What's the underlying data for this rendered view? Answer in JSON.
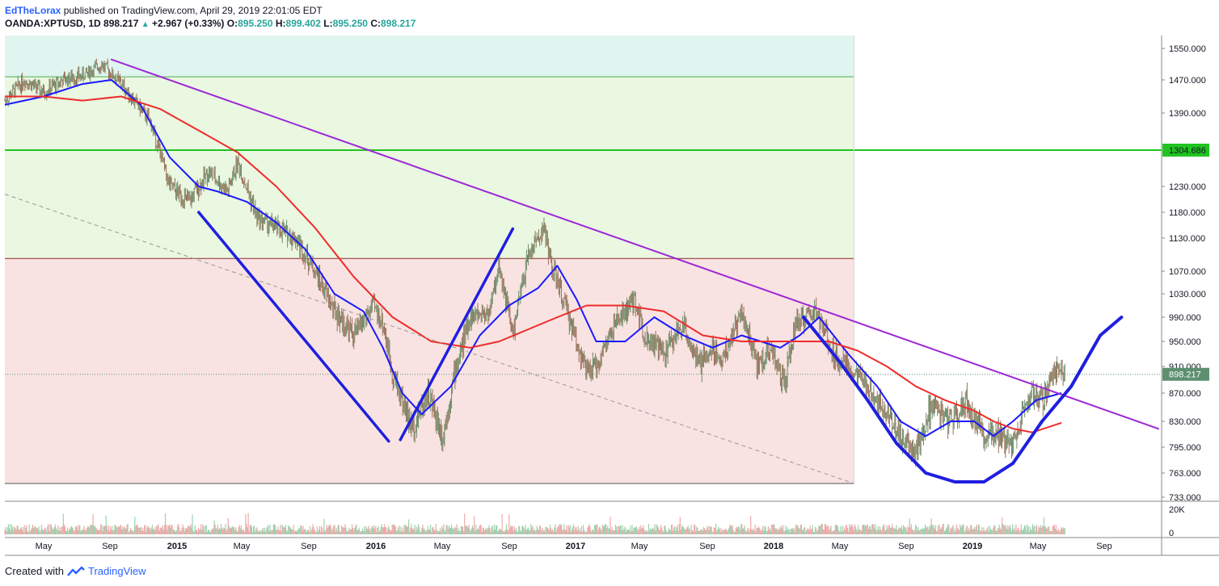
{
  "header": {
    "author": "EdTheLorax",
    "published": "published on TradingView.com, April 29, 2019 22:01:05 EDT",
    "symbol": "OANDA:XPTUSD, 1D",
    "last": "898.217",
    "change_arrow": "▲",
    "change": "+2.967 (+0.33%)",
    "o_label": "O:",
    "o": "895.250",
    "h_label": "H:",
    "h": "899.402",
    "l_label": "L:",
    "l": "895.250",
    "c_label": "C:",
    "c": "898.217"
  },
  "footer": {
    "created_with": "Created with",
    "brand": "TradingView",
    "logo_icon": "tradingview-logo-icon"
  },
  "colors": {
    "ma_fast": "#1a1aff",
    "ma_slow": "#ef2b2b",
    "trend": "#9c27d6",
    "channel": "#1f1fe0",
    "level_green": "#21c321",
    "candle_up": "#6c8e6a",
    "candle_down": "#9a7058",
    "zone_top": "#e0f5ef",
    "zone_mid": "#eaf7e1",
    "zone_low": "#f8e3e2",
    "last_price_tag": "#5d8f70"
  },
  "chart_data": {
    "type": "line",
    "title": "",
    "price_ticks": [
      "1550.000",
      "1470.000",
      "1390.000",
      "1304.686",
      "1230.000",
      "1180.000",
      "1130.000",
      "1070.000",
      "1030.000",
      "990.000",
      "950.000",
      "910.000",
      "898.217",
      "870.000",
      "830.000",
      "795.000",
      "763.000",
      "733.000"
    ],
    "volume_ticks": [
      "20K",
      "0"
    ],
    "time_ticks": [
      "May",
      "Sep",
      "2015",
      "May",
      "Sep",
      "2016",
      "May",
      "Sep",
      "2017",
      "May",
      "Sep",
      "2018",
      "May",
      "Sep",
      "2019",
      "May",
      "Sep"
    ],
    "last_price": 898.217,
    "horizontal_levels": [
      1478,
      1304.686,
      1093,
      750
    ],
    "x_unit": "years (decimal)",
    "price_path": [
      [
        2014.0,
        1420
      ],
      [
        2014.1,
        1470
      ],
      [
        2014.2,
        1440
      ],
      [
        2014.3,
        1470
      ],
      [
        2014.4,
        1480
      ],
      [
        2014.5,
        1510
      ],
      [
        2014.6,
        1460
      ],
      [
        2014.75,
        1370
      ],
      [
        2014.85,
        1230
      ],
      [
        2014.95,
        1200
      ],
      [
        2015.05,
        1260
      ],
      [
        2015.15,
        1220
      ],
      [
        2015.2,
        1280
      ],
      [
        2015.3,
        1170
      ],
      [
        2015.4,
        1150
      ],
      [
        2015.5,
        1130
      ],
      [
        2015.6,
        1070
      ],
      [
        2015.7,
        1000
      ],
      [
        2015.8,
        960
      ],
      [
        2015.9,
        1010
      ],
      [
        2015.95,
        980
      ],
      [
        2016.0,
        900
      ],
      [
        2016.05,
        860
      ],
      [
        2016.1,
        820
      ],
      [
        2016.18,
        870
      ],
      [
        2016.26,
        810
      ],
      [
        2016.32,
        900
      ],
      [
        2016.4,
        990
      ],
      [
        2016.5,
        1000
      ],
      [
        2016.55,
        1080
      ],
      [
        2016.62,
        960
      ],
      [
        2016.7,
        1100
      ],
      [
        2016.78,
        1150
      ],
      [
        2016.82,
        1080
      ],
      [
        2016.88,
        1020
      ],
      [
        2016.95,
        950
      ],
      [
        2017.0,
        900
      ],
      [
        2017.05,
        910
      ],
      [
        2017.15,
        980
      ],
      [
        2017.25,
        1020
      ],
      [
        2017.3,
        960
      ],
      [
        2017.4,
        930
      ],
      [
        2017.5,
        980
      ],
      [
        2017.58,
        910
      ],
      [
        2017.65,
        940
      ],
      [
        2017.7,
        920
      ],
      [
        2017.8,
        1000
      ],
      [
        2017.88,
        910
      ],
      [
        2017.95,
        940
      ],
      [
        2018.02,
        880
      ],
      [
        2018.08,
        980
      ],
      [
        2018.18,
        1000
      ],
      [
        2018.28,
        930
      ],
      [
        2018.38,
        900
      ],
      [
        2018.48,
        870
      ],
      [
        2018.56,
        840
      ],
      [
        2018.62,
        810
      ],
      [
        2018.7,
        790
      ],
      [
        2018.78,
        850
      ],
      [
        2018.88,
        830
      ],
      [
        2018.96,
        860
      ],
      [
        2019.04,
        810
      ],
      [
        2019.1,
        820
      ],
      [
        2019.18,
        800
      ],
      [
        2019.24,
        830
      ],
      [
        2019.3,
        870
      ],
      [
        2019.36,
        860
      ],
      [
        2019.42,
        905
      ],
      [
        2019.47,
        898
      ]
    ],
    "series": [
      {
        "name": "",
        "color_key": "ma_fast",
        "values": [
          [
            2014.0,
            1410
          ],
          [
            2014.2,
            1430
          ],
          [
            2014.4,
            1460
          ],
          [
            2014.55,
            1470
          ],
          [
            2014.7,
            1410
          ],
          [
            2014.85,
            1290
          ],
          [
            2015.0,
            1230
          ],
          [
            2015.1,
            1220
          ],
          [
            2015.25,
            1200
          ],
          [
            2015.4,
            1160
          ],
          [
            2015.55,
            1110
          ],
          [
            2015.7,
            1030
          ],
          [
            2015.85,
            1000
          ],
          [
            2015.95,
            940
          ],
          [
            2016.05,
            870
          ],
          [
            2016.15,
            840
          ],
          [
            2016.3,
            880
          ],
          [
            2016.45,
            960
          ],
          [
            2016.6,
            1010
          ],
          [
            2016.75,
            1040
          ],
          [
            2016.85,
            1080
          ],
          [
            2016.95,
            1020
          ],
          [
            2017.05,
            950
          ],
          [
            2017.2,
            950
          ],
          [
            2017.35,
            990
          ],
          [
            2017.5,
            960
          ],
          [
            2017.65,
            940
          ],
          [
            2017.8,
            960
          ],
          [
            2017.9,
            950
          ],
          [
            2018.0,
            940
          ],
          [
            2018.1,
            960
          ],
          [
            2018.2,
            990
          ],
          [
            2018.35,
            930
          ],
          [
            2018.5,
            880
          ],
          [
            2018.62,
            830
          ],
          [
            2018.75,
            810
          ],
          [
            2018.88,
            830
          ],
          [
            2019.0,
            830
          ],
          [
            2019.1,
            810
          ],
          [
            2019.2,
            830
          ],
          [
            2019.32,
            860
          ],
          [
            2019.45,
            870
          ]
        ]
      },
      {
        "name": "",
        "color_key": "ma_slow",
        "values": [
          [
            2014.0,
            1430
          ],
          [
            2014.2,
            1430
          ],
          [
            2014.4,
            1420
          ],
          [
            2014.6,
            1430
          ],
          [
            2014.8,
            1400
          ],
          [
            2015.0,
            1350
          ],
          [
            2015.2,
            1300
          ],
          [
            2015.4,
            1230
          ],
          [
            2015.6,
            1150
          ],
          [
            2015.8,
            1060
          ],
          [
            2016.0,
            990
          ],
          [
            2016.2,
            950
          ],
          [
            2016.4,
            940
          ],
          [
            2016.55,
            950
          ],
          [
            2016.7,
            970
          ],
          [
            2016.85,
            990
          ],
          [
            2017.0,
            1010
          ],
          [
            2017.2,
            1010
          ],
          [
            2017.4,
            1000
          ],
          [
            2017.6,
            960
          ],
          [
            2017.8,
            950
          ],
          [
            2017.95,
            950
          ],
          [
            2018.1,
            950
          ],
          [
            2018.25,
            950
          ],
          [
            2018.4,
            935
          ],
          [
            2018.55,
            910
          ],
          [
            2018.7,
            880
          ],
          [
            2018.85,
            860
          ],
          [
            2019.0,
            845
          ],
          [
            2019.1,
            830
          ],
          [
            2019.2,
            820
          ],
          [
            2019.3,
            815
          ],
          [
            2019.45,
            828
          ]
        ]
      }
    ],
    "drawings": [
      {
        "kind": "trendline",
        "color_key": "trend",
        "from": [
          2014.55,
          1522
        ],
        "to": [
          2019.95,
          820
        ]
      },
      {
        "kind": "dashed",
        "from": [
          2014.0,
          1215
        ],
        "to": [
          2018.38,
          750
        ]
      },
      {
        "kind": "channel",
        "color_key": "channel",
        "from": [
          2015.0,
          1180
        ],
        "to": [
          2015.98,
          803
        ]
      },
      {
        "kind": "channel",
        "color_key": "channel",
        "from": [
          2016.04,
          805
        ],
        "to": [
          2016.62,
          1148
        ]
      },
      {
        "kind": "arc",
        "color_key": "channel",
        "points": [
          [
            2018.12,
            990
          ],
          [
            2018.3,
            920
          ],
          [
            2018.45,
            860
          ],
          [
            2018.6,
            800
          ],
          [
            2018.75,
            763
          ],
          [
            2018.9,
            752
          ],
          [
            2019.05,
            752
          ],
          [
            2019.2,
            775
          ],
          [
            2019.35,
            830
          ],
          [
            2019.5,
            880
          ],
          [
            2019.65,
            960
          ],
          [
            2019.76,
            990
          ]
        ]
      }
    ]
  }
}
